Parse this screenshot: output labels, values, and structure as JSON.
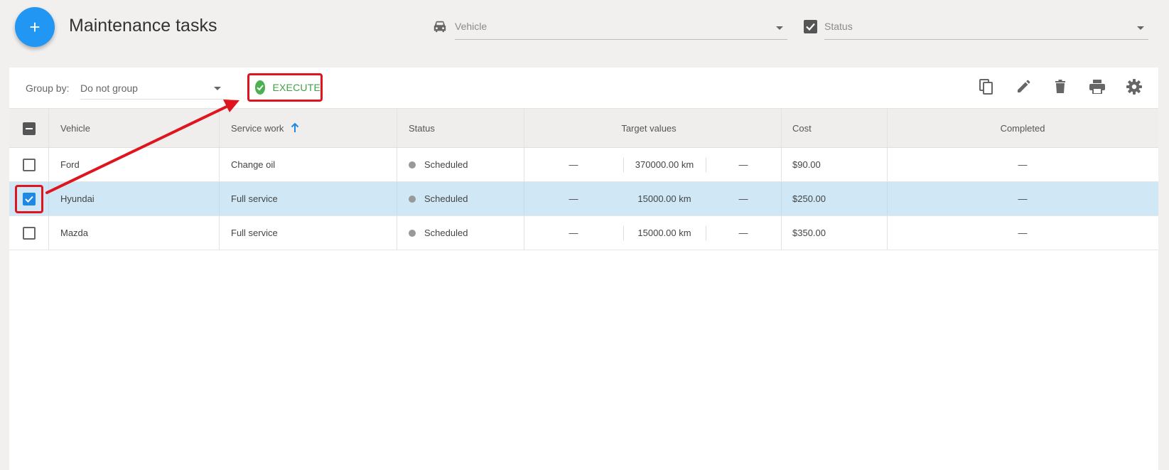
{
  "header": {
    "add_label": "+",
    "title": "Maintenance tasks",
    "vehicle_filter_placeholder": "Vehicle",
    "status_filter_placeholder": "Status"
  },
  "toolbar": {
    "group_by_label": "Group by:",
    "group_by_value": "Do not group",
    "execute_label": "EXECUTE",
    "icons": [
      "copy-icon",
      "edit-icon",
      "delete-icon",
      "print-icon",
      "settings-icon"
    ]
  },
  "table": {
    "columns": {
      "vehicle": "Vehicle",
      "service_work": "Service work",
      "status": "Status",
      "target_values": "Target values",
      "cost": "Cost",
      "completed": "Completed"
    },
    "rows": [
      {
        "vehicle": "Ford",
        "service_work": "Change oil",
        "status": "Scheduled",
        "target_left": "—",
        "target_mid": "370000.00 km",
        "target_right": "—",
        "cost": "$90.00",
        "completed": "—",
        "checked": false
      },
      {
        "vehicle": "Hyundai",
        "service_work": "Full service",
        "status": "Scheduled",
        "target_left": "—",
        "target_mid": "15000.00 km",
        "target_right": "—",
        "cost": "$250.00",
        "completed": "—",
        "checked": true
      },
      {
        "vehicle": "Mazda",
        "service_work": "Full service",
        "status": "Scheduled",
        "target_left": "—",
        "target_mid": "15000.00 km",
        "target_right": "—",
        "cost": "$350.00",
        "completed": "—",
        "checked": false
      }
    ]
  },
  "colors": {
    "accent": "#2196f3",
    "execute_green": "#43a047",
    "highlight_red": "#e0141e",
    "selected_row": "#d0e8f6",
    "status_dot": "#999999"
  }
}
